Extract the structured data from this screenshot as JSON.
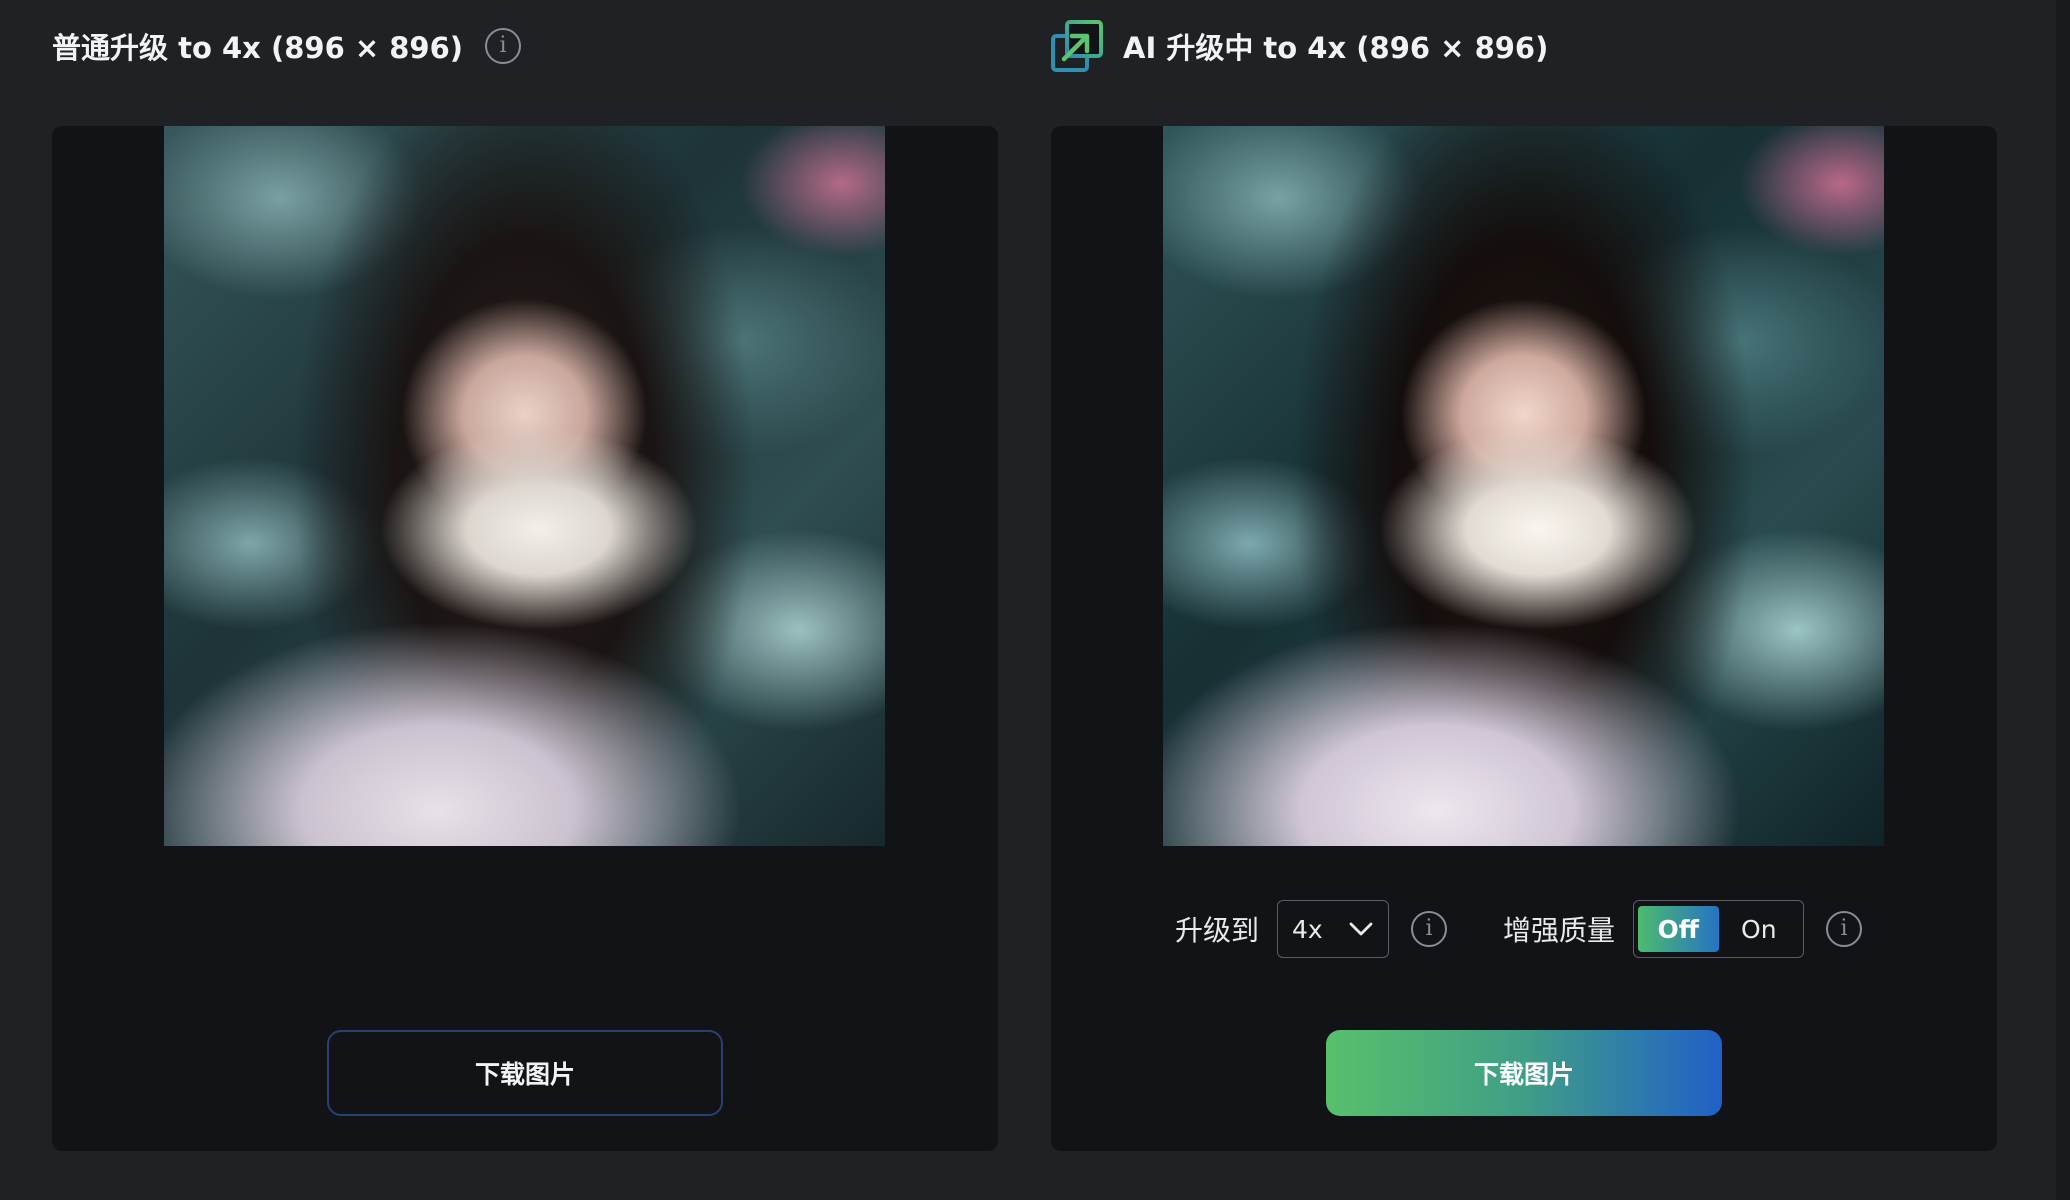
{
  "left": {
    "title": "普通升级 to 4x (896 × 896)",
    "info_icon": "info-icon",
    "image_alt": "upscaled-portrait-standard",
    "download_label": "下载图片"
  },
  "right": {
    "title": "AI 升级中 to 4x (896 × 896)",
    "logo_icon": "ai-upscale-logo-icon",
    "image_alt": "upscaled-portrait-ai",
    "upscale_label": "升级到",
    "upscale_value": "4x",
    "quality_label": "增强质量",
    "toggle_off": "Off",
    "toggle_on": "On",
    "toggle_state": "Off",
    "download_label": "下载图片"
  },
  "colors": {
    "background": "#202124",
    "panel": "#121316",
    "button_border": "#2a3f73",
    "gradient_start": "#58c06c",
    "gradient_end": "#2160c7"
  }
}
